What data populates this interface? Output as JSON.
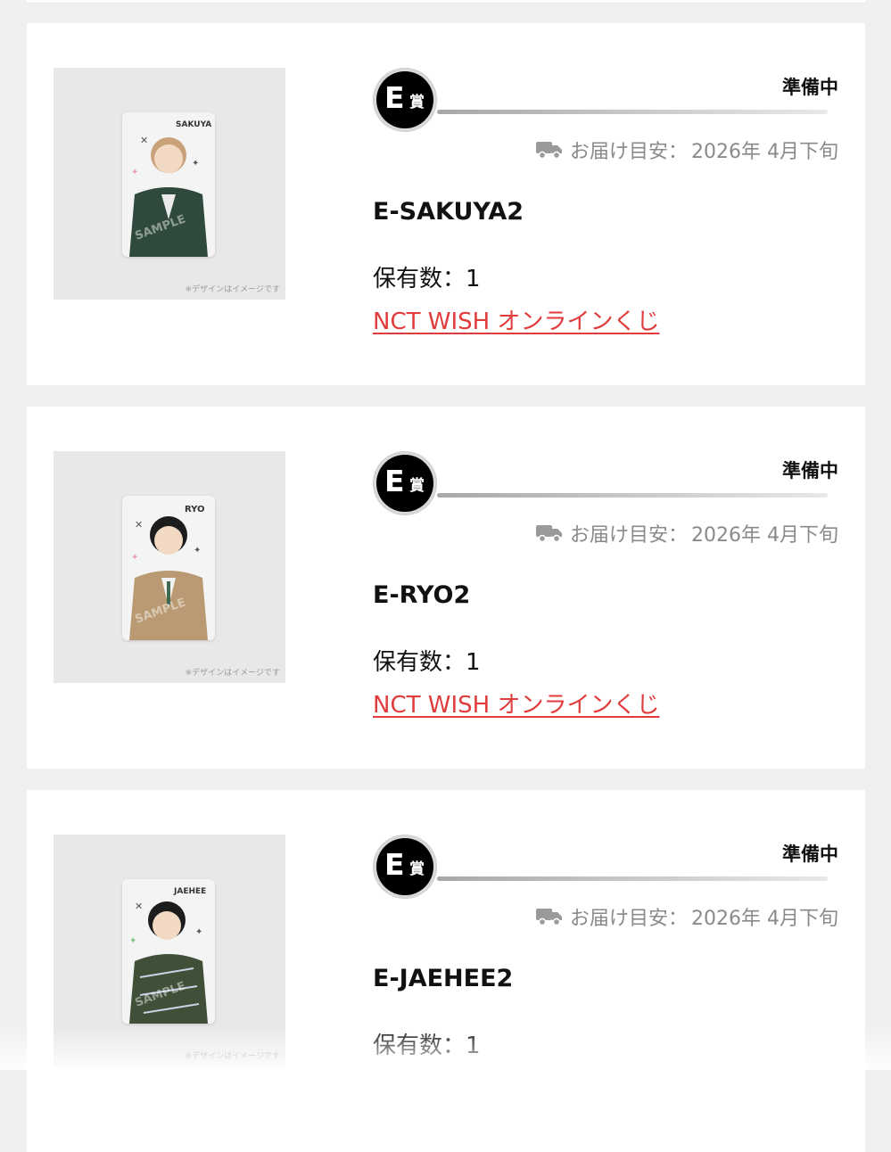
{
  "items": [
    {
      "badge_letter": "E",
      "badge_suffix": "賞",
      "status": "準備中",
      "delivery_label": "お届け目安：",
      "delivery_date": "2026年 4月下旬",
      "name": "E-SAKUYA2",
      "qty_label": "保有数：",
      "qty": "1",
      "link": "NCT WISH オンラインくじ",
      "image_note": "※デザインはイメージです",
      "card_text": "SAKUYA",
      "watermark": "SAMPLE",
      "jacket_color": "#2f4a3c"
    },
    {
      "badge_letter": "E",
      "badge_suffix": "賞",
      "status": "準備中",
      "delivery_label": "お届け目安：",
      "delivery_date": "2026年 4月下旬",
      "name": "E-RYO2",
      "qty_label": "保有数：",
      "qty": "1",
      "link": "NCT WISH オンラインくじ",
      "image_note": "※デザインはイメージです",
      "card_text": "RYO",
      "watermark": "SAMPLE",
      "jacket_color": "#b99a72"
    },
    {
      "badge_letter": "E",
      "badge_suffix": "賞",
      "status": "準備中",
      "delivery_label": "お届け目安：",
      "delivery_date": "2026年 4月下旬",
      "name": "E-JAEHEE2",
      "qty_label": "保有数：",
      "qty": "1",
      "link": "",
      "image_note": "※デザインはイメージです",
      "card_text": "JAEHEE",
      "watermark": "SAMPLE",
      "jacket_color": "#3f4f38"
    }
  ]
}
